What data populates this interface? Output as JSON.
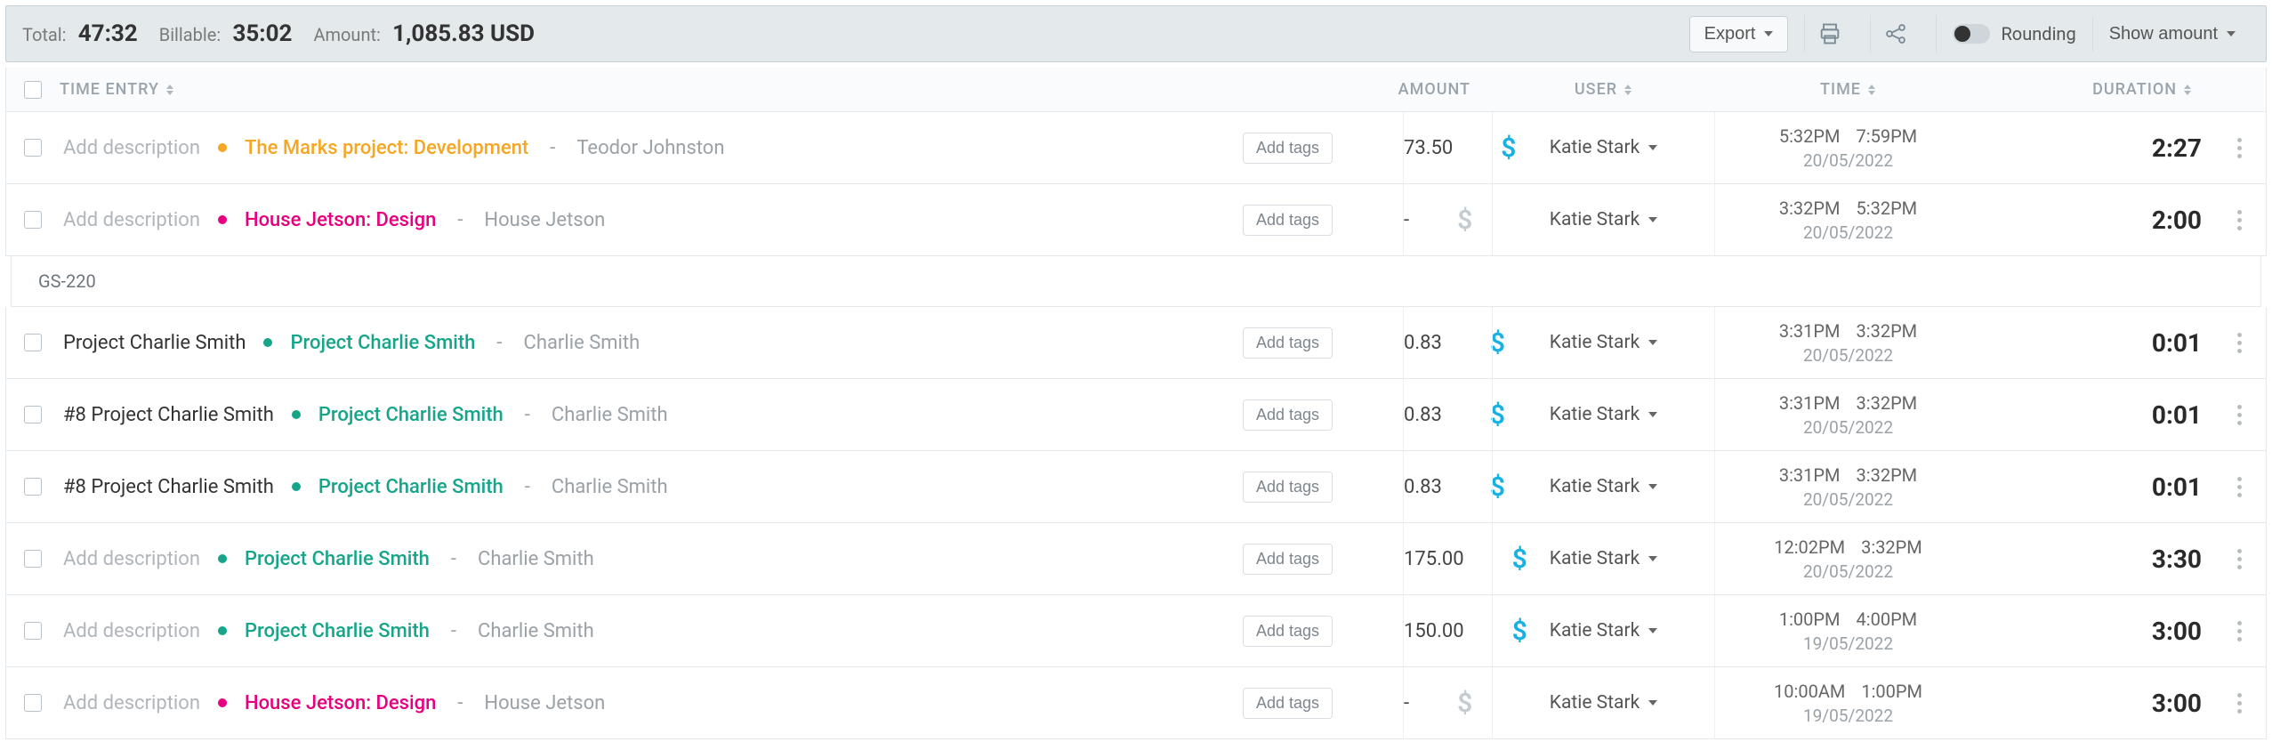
{
  "summary": {
    "total_label": "Total:",
    "total_value": "47:32",
    "billable_label": "Billable:",
    "billable_value": "35:02",
    "amount_label": "Amount:",
    "amount_value": "1,085.83 USD",
    "export_label": "Export",
    "rounding_label": "Rounding",
    "show_amount_label": "Show amount"
  },
  "columns": {
    "time_entry": "TIME ENTRY",
    "amount": "AMOUNT",
    "user": "USER",
    "time": "TIME",
    "duration": "DURATION"
  },
  "add_tags_label": "Add tags",
  "add_description_placeholder": "Add description",
  "groups": [
    {
      "label": "GS-220",
      "after_index": 1
    }
  ],
  "entries": [
    {
      "description": "",
      "project": {
        "name": "The Marks project: Development",
        "color": "#f5a623",
        "client": "Teodor Johnston"
      },
      "amount": "73.50",
      "billable": true,
      "user": "Katie Stark",
      "time_start": "5:32PM",
      "time_end": "7:59PM",
      "date": "20/05/2022",
      "duration": "2:27"
    },
    {
      "description": "",
      "project": {
        "name": "House Jetson: Design",
        "color": "#e6007e",
        "client": "House Jetson"
      },
      "amount": "-",
      "billable": false,
      "user": "Katie Stark",
      "time_start": "3:32PM",
      "time_end": "5:32PM",
      "date": "20/05/2022",
      "duration": "2:00"
    },
    {
      "description": "Project Charlie Smith",
      "project": {
        "name": "Project Charlie Smith",
        "color": "#17a589",
        "client": "Charlie Smith"
      },
      "amount": "0.83",
      "billable": true,
      "user": "Katie Stark",
      "time_start": "3:31PM",
      "time_end": "3:32PM",
      "date": "20/05/2022",
      "duration": "0:01"
    },
    {
      "description": "#8 Project Charlie Smith",
      "project": {
        "name": "Project Charlie Smith",
        "color": "#17a589",
        "client": "Charlie Smith"
      },
      "amount": "0.83",
      "billable": true,
      "user": "Katie Stark",
      "time_start": "3:31PM",
      "time_end": "3:32PM",
      "date": "20/05/2022",
      "duration": "0:01"
    },
    {
      "description": "#8 Project Charlie Smith",
      "project": {
        "name": "Project Charlie Smith",
        "color": "#17a589",
        "client": "Charlie Smith"
      },
      "amount": "0.83",
      "billable": true,
      "user": "Katie Stark",
      "time_start": "3:31PM",
      "time_end": "3:32PM",
      "date": "20/05/2022",
      "duration": "0:01"
    },
    {
      "description": "",
      "project": {
        "name": "Project Charlie Smith",
        "color": "#17a589",
        "client": "Charlie Smith"
      },
      "amount": "175.00",
      "billable": true,
      "user": "Katie Stark",
      "time_start": "12:02PM",
      "time_end": "3:32PM",
      "date": "20/05/2022",
      "duration": "3:30"
    },
    {
      "description": "",
      "project": {
        "name": "Project Charlie Smith",
        "color": "#17a589",
        "client": "Charlie Smith"
      },
      "amount": "150.00",
      "billable": true,
      "user": "Katie Stark",
      "time_start": "1:00PM",
      "time_end": "4:00PM",
      "date": "19/05/2022",
      "duration": "3:00"
    },
    {
      "description": "",
      "project": {
        "name": "House Jetson: Design",
        "color": "#e6007e",
        "client": "House Jetson"
      },
      "amount": "-",
      "billable": false,
      "user": "Katie Stark",
      "time_start": "10:00AM",
      "time_end": "1:00PM",
      "date": "19/05/2022",
      "duration": "3:00"
    }
  ]
}
